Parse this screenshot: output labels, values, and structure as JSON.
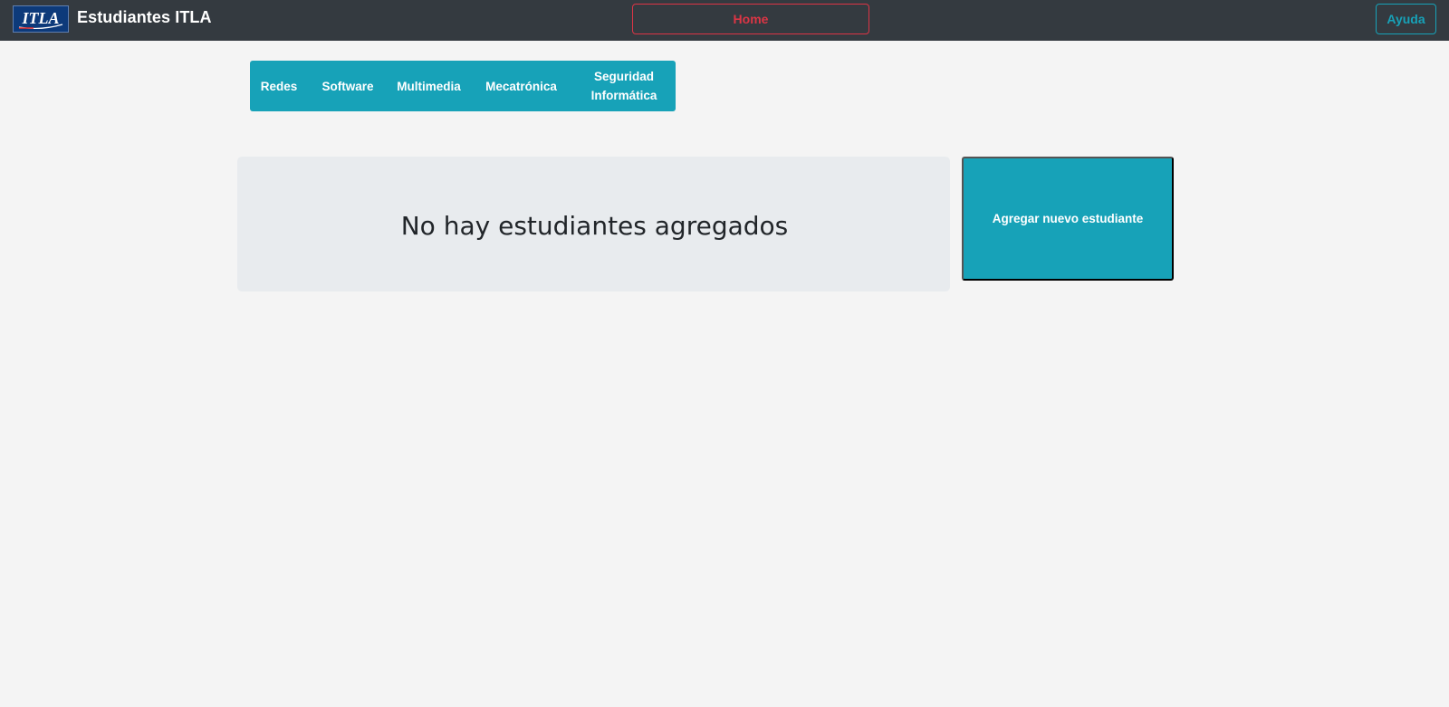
{
  "navbar": {
    "logo_text": "ITLA",
    "title": "Estudiantes ITLA",
    "home_label": "Home",
    "help_label": "Ayuda"
  },
  "careers": {
    "items": [
      {
        "label": "Redes"
      },
      {
        "label": "Software"
      },
      {
        "label": "Multimedia"
      },
      {
        "label": "Mecatrónica"
      },
      {
        "label": "Seguridad Informática"
      }
    ]
  },
  "main": {
    "empty_message": "No hay estudiantes agregados",
    "add_button_label": "Agregar nuevo estudiante"
  },
  "colors": {
    "navbar_bg": "#343a40",
    "accent_info": "#17a2b8",
    "accent_danger": "#dc3545",
    "page_bg": "#f4f4f4",
    "panel_bg": "#e8ebee"
  },
  "icons": {
    "logo": "itla-logo"
  }
}
